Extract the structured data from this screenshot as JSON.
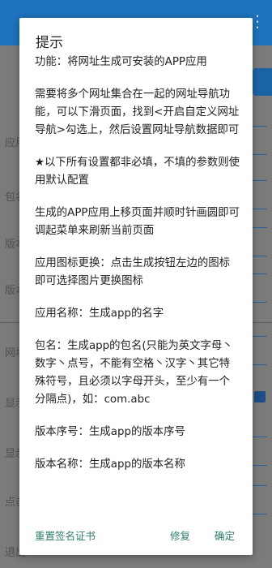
{
  "background": {
    "rows": [
      "应用",
      "包名",
      "版本",
      "版本",
      "网址",
      "显示",
      "显示",
      "点击",
      "退出"
    ]
  },
  "dialog": {
    "title": "提示",
    "paragraphs": [
      "功能：将网址生成可安装的APP应用",
      "需要将多个网址集合在一起的网址导航功能，可以下滑页面，找到<开启自定义网址导航>勾选上，然后设置网址导航数据即可",
      "★以下所有设置都非必填，不填的参数则使用默认配置",
      "生成的APP应用上移页面并顺时针画圆即可调起菜单来刷新当前页面",
      "应用图标更换：点击生成按钮左边的图标即可选择图片更换图标",
      "应用名称：生成app的名字",
      "包名：生成app的包名(只能为英文字母丶数字丶点号，不能有空格丶汉字丶其它特殊符号，且必须以字母开头，至少有一个分隔点)，如：com.abc",
      "版本序号：生成app的版本序号",
      "版本名称：生成app的版本名称"
    ],
    "buttons": {
      "reset_signature": "重置签名证书",
      "repair": "修复",
      "confirm": "确定"
    }
  },
  "colors": {
    "accent": "#2a7d6a",
    "header": "#1e73bd"
  }
}
